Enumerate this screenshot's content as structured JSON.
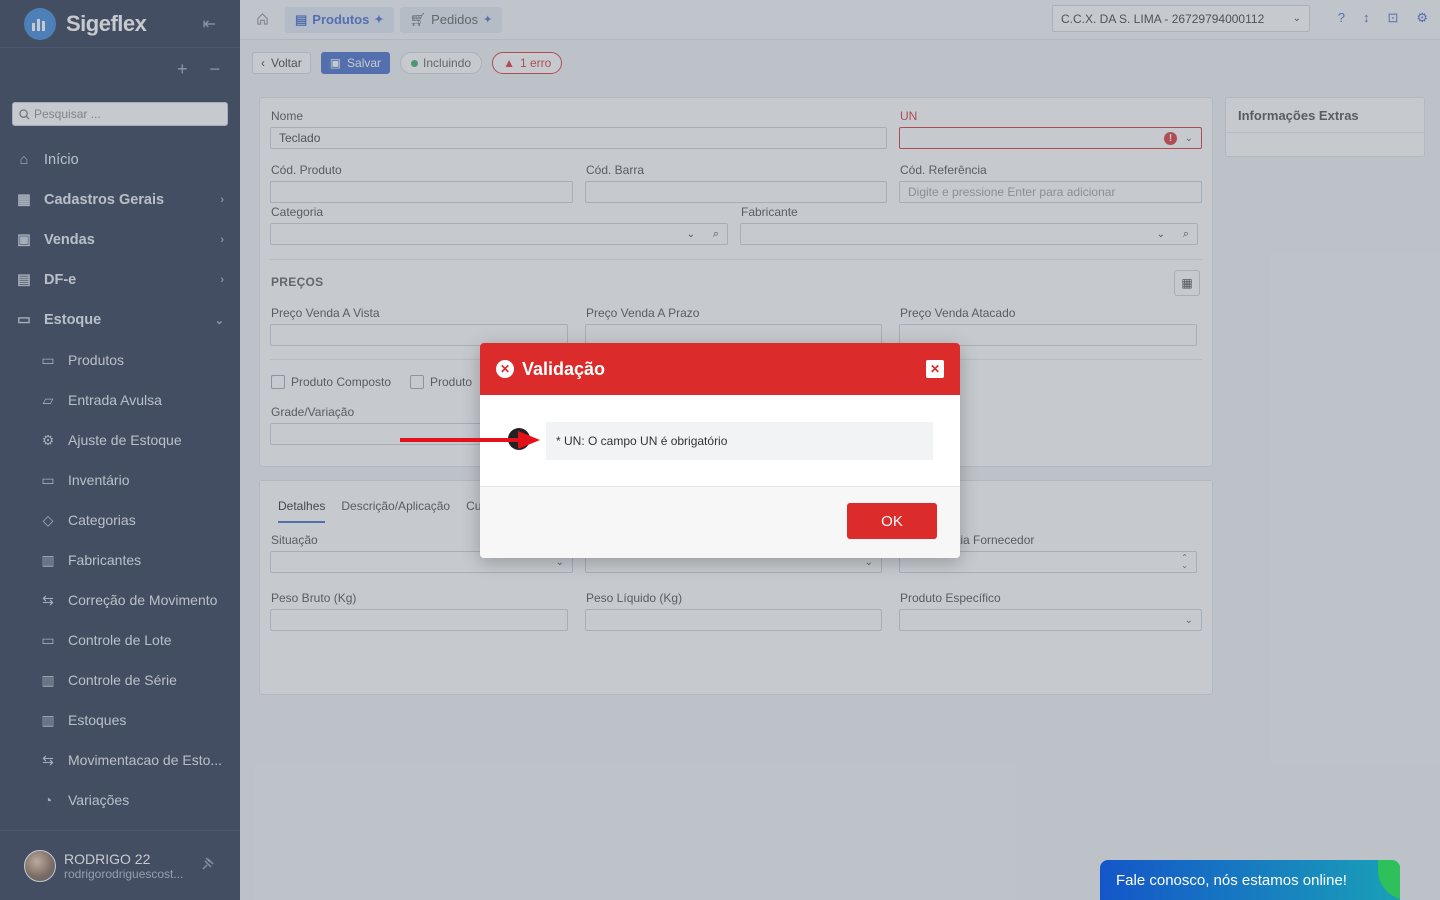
{
  "app": {
    "name": "Sigeflex"
  },
  "sidebar": {
    "search_placeholder": "Pesquisar ...",
    "items": [
      {
        "label": "Início",
        "icon": "home-icon",
        "level": "top",
        "bold": false
      },
      {
        "label": "Cadastros Gerais",
        "icon": "grid-icon",
        "level": "top",
        "bold": true,
        "chevron": "›"
      },
      {
        "label": "Vendas",
        "icon": "bag-icon",
        "level": "top",
        "bold": true,
        "chevron": "›"
      },
      {
        "label": "DF-e",
        "icon": "document-icon",
        "level": "top",
        "bold": true,
        "chevron": "›"
      },
      {
        "label": "Estoque",
        "icon": "archive-icon",
        "level": "top",
        "bold": true,
        "chevron": "⌄"
      },
      {
        "label": "Produtos",
        "icon": "box-icon",
        "level": "sub"
      },
      {
        "label": "Entrada Avulsa",
        "icon": "inbox-icon",
        "level": "sub"
      },
      {
        "label": "Ajuste de Estoque",
        "icon": "gear-icon",
        "level": "sub"
      },
      {
        "label": "Inventário",
        "icon": "box-icon",
        "level": "sub"
      },
      {
        "label": "Categorias",
        "icon": "tag-icon",
        "level": "sub"
      },
      {
        "label": "Fabricantes",
        "icon": "factory-icon",
        "level": "sub"
      },
      {
        "label": "Correção de Movimento",
        "icon": "swap-icon",
        "level": "sub"
      },
      {
        "label": "Controle de Lote",
        "icon": "box-icon",
        "level": "sub"
      },
      {
        "label": "Controle de Série",
        "icon": "barcode-icon",
        "level": "sub"
      },
      {
        "label": "Estoques",
        "icon": "factory-icon",
        "level": "sub"
      },
      {
        "label": "Movimentacao de Esto...",
        "icon": "swap-icon",
        "level": "sub"
      },
      {
        "label": "Variações",
        "icon": "palette-icon",
        "level": "sub"
      }
    ],
    "user": {
      "name": "RODRIGO 22",
      "email": "rodrigorodriguescost..."
    }
  },
  "topbar": {
    "tabs": [
      {
        "label": "Produtos"
      },
      {
        "label": "Pedidos"
      }
    ],
    "company": "C.C.X. DA S. LIMA - 26729794000112"
  },
  "toolbar": {
    "back": "Voltar",
    "save": "Salvar",
    "status": "Incluindo",
    "errors": "1 erro"
  },
  "form": {
    "nome_label": "Nome",
    "nome_value": "Teclado",
    "un_label": "UN",
    "cod_produto_label": "Cód. Produto",
    "cod_barra_label": "Cód. Barra",
    "cod_ref_label": "Cód. Referência",
    "cod_ref_placeholder": "Digite e pressione Enter para adicionar",
    "categoria_label": "Categoria",
    "fabricante_label": "Fabricante",
    "precos_title": "PREÇOS",
    "preco_vista_label": "Preço Venda A Vista",
    "preco_prazo_label": "Preço Venda A Prazo",
    "preco_atacado_label": "Preço Venda Atacado",
    "produto_composto": "Produto Composto",
    "produto_other": "Produto",
    "grade_label": "Grade/Variação"
  },
  "side_panel": {
    "title": "Informações Extras"
  },
  "details": {
    "tabs": [
      "Detalhes",
      "Descrição/Aplicação",
      "Cu"
    ],
    "situacao_label": "Situação",
    "garantia_label": "tia Fornecedor",
    "peso_bruto_label": "Peso Bruto (Kg)",
    "peso_liquido_label": "Peso Líquido (Kg)",
    "produto_especifico_label": "Produto Específico"
  },
  "modal": {
    "title": "Validação",
    "message": "* UN: O campo UN é obrigatório",
    "ok": "OK"
  },
  "chat": {
    "label": "Fale conosco, nós estamos online!"
  },
  "colors": {
    "accent": "#3b63c6",
    "error": "#dc2b2b",
    "sidebar": "#1f2a44"
  }
}
